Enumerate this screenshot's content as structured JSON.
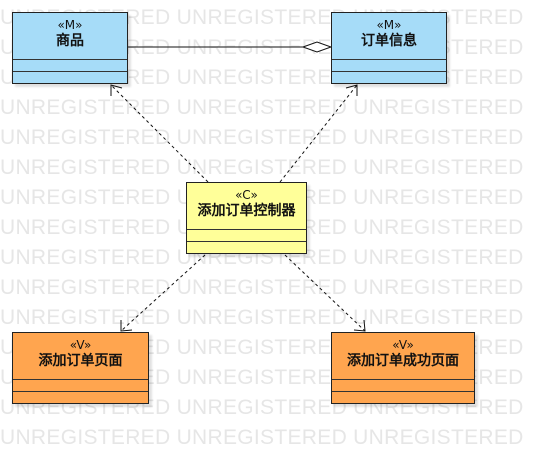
{
  "watermark": "UNREGISTERED UNREGISTERED UNREGISTERED",
  "colors": {
    "model": "#a6dcf8",
    "controller": "#ffff99",
    "view": "#ffa54f"
  },
  "classes": {
    "goods": {
      "stereotype": "«M»",
      "name": "商品"
    },
    "order_info": {
      "stereotype": "«M»",
      "name": "订单信息"
    },
    "controller": {
      "stereotype": "«C»",
      "name": "添加订单控制器"
    },
    "add_page": {
      "stereotype": "«V»",
      "name": "添加订单页面"
    },
    "success_page": {
      "stereotype": "«V»",
      "name": "添加订单成功页面"
    }
  },
  "relations": [
    {
      "type": "aggregation",
      "from": "商品",
      "to": "订单信息"
    },
    {
      "type": "dependency",
      "from": "添加订单控制器",
      "to": "商品"
    },
    {
      "type": "dependency",
      "from": "添加订单控制器",
      "to": "订单信息"
    },
    {
      "type": "dependency",
      "from": "添加订单控制器",
      "to": "添加订单页面"
    },
    {
      "type": "dependency",
      "from": "添加订单控制器",
      "to": "添加订单成功页面"
    }
  ]
}
